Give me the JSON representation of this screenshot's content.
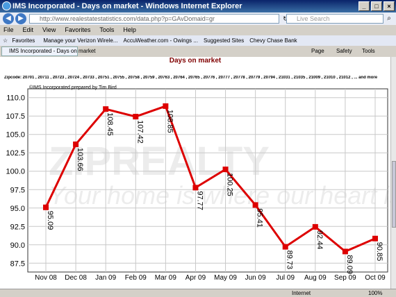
{
  "window": {
    "title": "IMS Incorporated - Days on market - Windows Internet Explorer"
  },
  "address": {
    "url": "http://www.realestatestatistics.com/data.php?p=GAvDomaid=gr",
    "search_placeholder": "Live Search"
  },
  "menu": [
    "File",
    "Edit",
    "View",
    "Favorites",
    "Tools",
    "Help"
  ],
  "favorites": {
    "label": "Favorites",
    "items": [
      "Manage your Verizon Wirele...",
      "AccuWeather.com - Owings ...",
      "Suggested Sites",
      "Chevy Chase Bank"
    ]
  },
  "tab": {
    "label": "IMS Incorporated - Days on market"
  },
  "commands": [
    "Page",
    "Safety",
    "Tools"
  ],
  "page": {
    "title": "Days on market",
    "zipcodes": "Zipcode: 20701 , 20711 , 20723 , 20724 , 20733 , 20751 , 20755 , 20758 , 20759 , 20763 , 20764 , 20765 , 20776 , 20777 , 20778 , 20779 , 20794 , 21031 , 21035 , 21009 , 21010 , 21012 , ... and more",
    "credit": "©IMS Incorporated prepared by Tim Bird",
    "watermark_brand": "ZIPREALTY",
    "watermark_tagline": "Your home is where our heart is."
  },
  "status": {
    "zone": "Internet",
    "zoom": "100%"
  },
  "chart_data": {
    "type": "line",
    "categories": [
      "Nov 08",
      "Dec 08",
      "Jan 09",
      "Feb 09",
      "Mar 09",
      "Apr 09",
      "May 09",
      "Jun 09",
      "Jul 09",
      "Aug 09",
      "Sep 09",
      "Oct 09"
    ],
    "values": [
      95.09,
      103.66,
      108.45,
      107.42,
      108.85,
      97.77,
      100.25,
      95.41,
      89.73,
      92.44,
      89.09,
      90.85
    ],
    "data_labels": [
      "95.09",
      "103.66",
      "108.45",
      "107.42",
      "108.85",
      "97.77",
      "100.25",
      "95.41",
      "89.73",
      "92.44",
      "89.09",
      "90.85"
    ],
    "y_ticks": [
      "110.0",
      "107.5",
      "105.0",
      "102.5",
      "100.0",
      "97.5",
      "95.0",
      "92.5",
      "90.0",
      "87.5"
    ],
    "ylim": [
      86.3,
      111.2
    ],
    "grid": true,
    "color": "#dd0000"
  }
}
